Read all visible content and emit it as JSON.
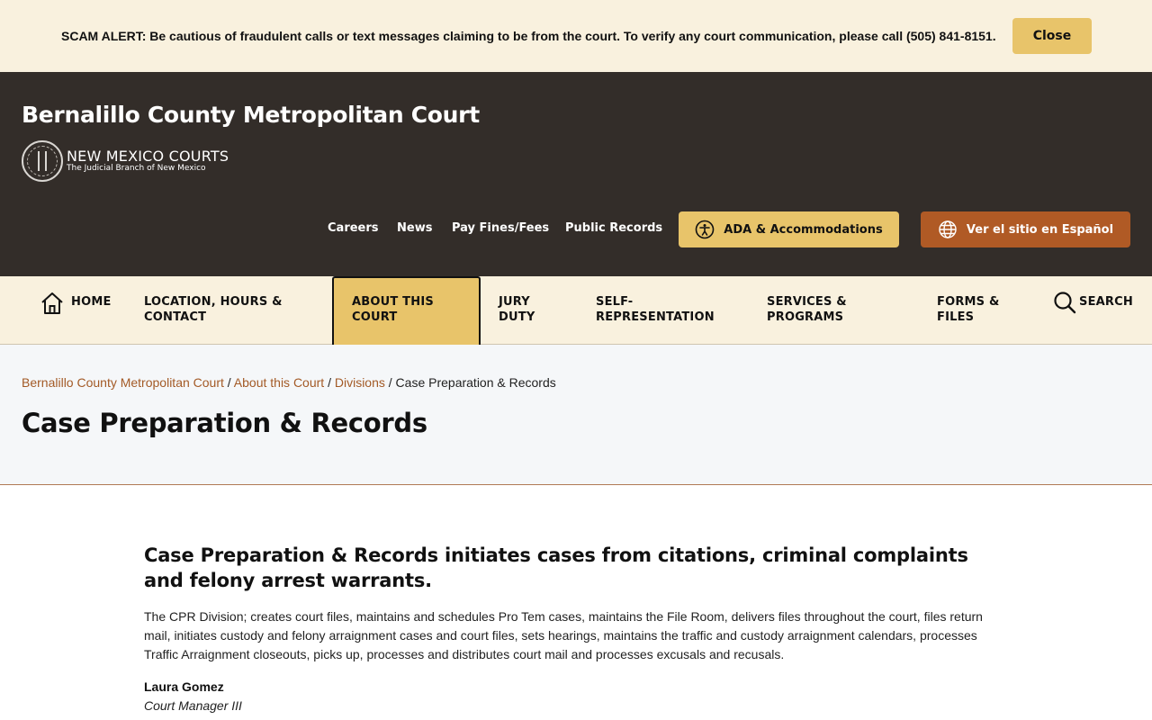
{
  "alert": {
    "text": "SCAM ALERT: Be cautious of fraudulent calls or text messages claiming to be from the court. To verify any court communication, please call (505) 841-8151.",
    "close_label": "Close"
  },
  "header": {
    "site_title": "Bernalillo County Metropolitan Court",
    "logo_name": "NEW MEXICO COURTS",
    "logo_tagline": "The Judicial Branch of New Mexico",
    "links": [
      "Careers",
      "News",
      "Pay Fines/Fees",
      "Public Records"
    ],
    "ada_label": "ADA & Accommodations",
    "spanish_label": "Ver el sitio en Español"
  },
  "nav": {
    "home": "HOME",
    "items": [
      "LOCATION, HOURS & CONTACT",
      "ABOUT THIS COURT",
      "JURY DUTY",
      "SELF-REPRESENTATION",
      "SERVICES & PROGRAMS",
      "FORMS & FILES"
    ],
    "search": "SEARCH",
    "active_item": "ABOUT THIS COURT"
  },
  "breadcrumb": {
    "items": [
      "Bernalillo County Metropolitan Court",
      "About this Court",
      "Divisions"
    ],
    "current": "Case Preparation & Records"
  },
  "page": {
    "title": "Case Preparation & Records",
    "heading": "Case Preparation & Records initiates cases from citations, criminal complaints and felony arrest warrants.",
    "body": "The CPR Division; creates court files, maintains and schedules Pro Tem cases, maintains the File Room, delivers files throughout the court, files return mail, initiates custody and felony arraignment cases and court files, sets hearings, maintains the traffic and custody arraignment calendars, processes Traffic Arraignment closeouts, picks up, processes and distributes court mail and processes excusals and recusals.",
    "contact_name": "Laura Gomez",
    "contact_title": "Court Manager III"
  },
  "colors": {
    "alert_bg": "#f9f1de",
    "header_bg": "#332d29",
    "accent_gold": "#e8c46a",
    "accent_rust": "#b05a25",
    "link": "#a35a26"
  }
}
